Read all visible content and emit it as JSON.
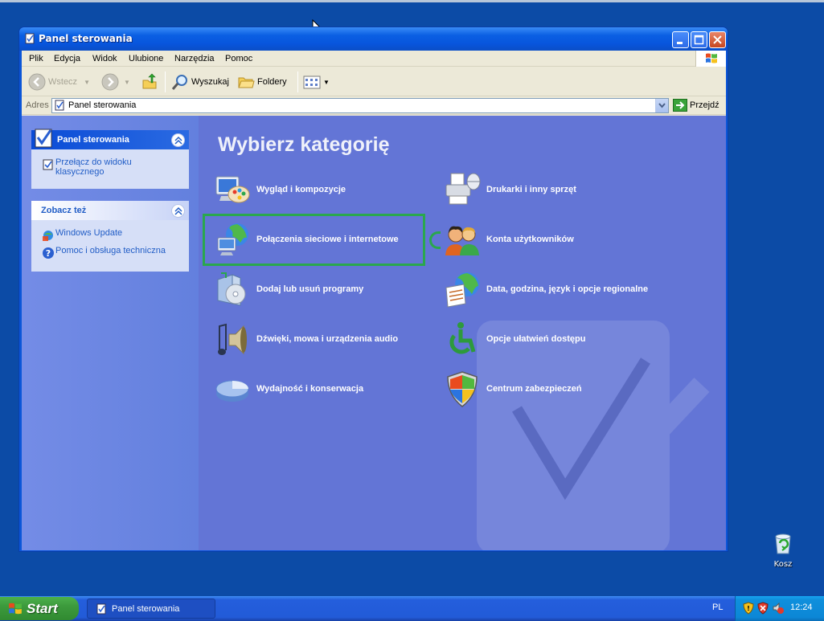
{
  "window": {
    "title": "Panel sterowania"
  },
  "menu": [
    "Plik",
    "Edycja",
    "Widok",
    "Ulubione",
    "Narzędzia",
    "Pomoc"
  ],
  "toolbar": {
    "back": "Wstecz",
    "search": "Wyszukaj",
    "folders": "Foldery"
  },
  "address": {
    "label": "Adres",
    "value": "Panel sterowania",
    "go": "Przejdź"
  },
  "left_panels": {
    "control_panel": {
      "title": "Panel sterowania",
      "link": "Przełącz do widoku klasycznego"
    },
    "see_also": {
      "title": "Zobacz też",
      "links": [
        "Windows Update",
        "Pomoc i obsługa techniczna"
      ]
    }
  },
  "main": {
    "heading": "Wybierz kategorię",
    "categories": [
      {
        "label": "Wygląd i kompozycje",
        "icon": "appearance-icon"
      },
      {
        "label": "Drukarki i inny sprzęt",
        "icon": "printer-icon"
      },
      {
        "label": "Połączenia sieciowe i internetowe",
        "icon": "network-icon",
        "highlighted": true
      },
      {
        "label": "Konta użytkowników",
        "icon": "users-icon"
      },
      {
        "label": "Dodaj lub usuń programy",
        "icon": "add-remove-icon"
      },
      {
        "label": "Data, godzina, język i opcje regionalne",
        "icon": "date-region-icon"
      },
      {
        "label": "Dźwięki, mowa i urządzenia audio",
        "icon": "sound-icon"
      },
      {
        "label": "Opcje ułatwień dostępu",
        "icon": "accessibility-icon"
      },
      {
        "label": "Wydajność i konserwacja",
        "icon": "performance-icon"
      },
      {
        "label": "Centrum zabezpieczeń",
        "icon": "security-shield-icon"
      }
    ],
    "highlight_color": "#2aa74d"
  },
  "desktop": {
    "recycle_bin": "Kosz"
  },
  "taskbar": {
    "start": "Start",
    "task": "Panel sterowania",
    "language": "PL",
    "time": "12:24"
  }
}
